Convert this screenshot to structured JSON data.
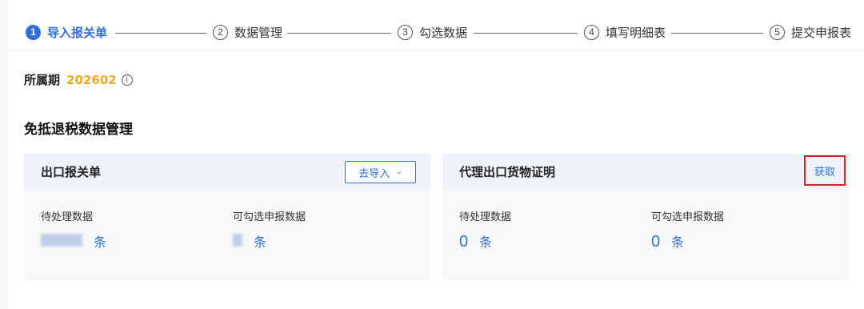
{
  "steps": [
    {
      "num": "1",
      "label": "导入报关单",
      "active": true
    },
    {
      "num": "2",
      "label": "数据管理"
    },
    {
      "num": "3",
      "label": "勾选数据"
    },
    {
      "num": "4",
      "label": "填写明细表"
    },
    {
      "num": "5",
      "label": "提交申报表"
    }
  ],
  "period": {
    "label": "所属期",
    "value": "202602",
    "info_icon": "info-circle-icon"
  },
  "section_title": "免抵退税数据管理",
  "cards": {
    "left": {
      "title": "出口报关单",
      "import_button": "去导入",
      "pending": {
        "label": "待处理数据",
        "value": "",
        "unit": "条"
      },
      "selectable": {
        "label": "可勾选申报数据",
        "value": "",
        "unit": "条"
      }
    },
    "right": {
      "title": "代理出口货物证明",
      "get_button": "获取",
      "pending": {
        "label": "待处理数据",
        "value": "0",
        "unit": "条"
      },
      "selectable": {
        "label": "可勾选申报数据",
        "value": "0",
        "unit": "条"
      }
    }
  },
  "colors": {
    "accent": "#2f6fd6",
    "period_value": "#f5a623",
    "highlight_border": "#e02020"
  }
}
